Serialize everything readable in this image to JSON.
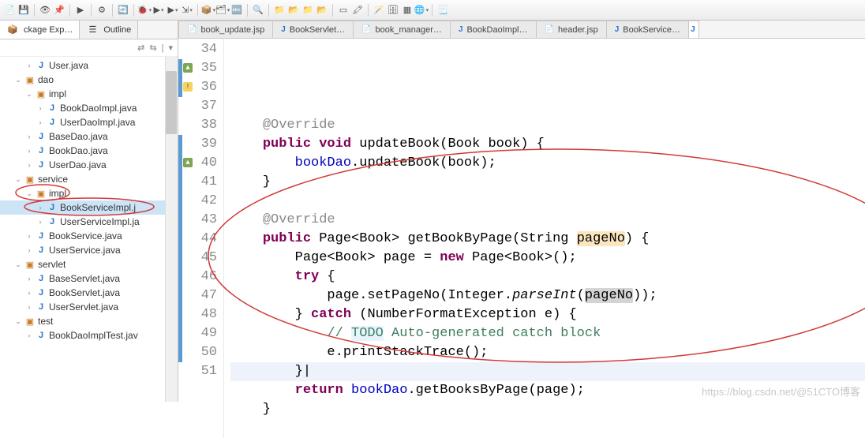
{
  "toolbar": {
    "icons": [
      "new",
      "save",
      "sep",
      "view",
      "pin",
      "sep",
      "play-green",
      "sep",
      "gear",
      "sep",
      "refresh",
      "sep",
      "debug-dd",
      "run-dd",
      "run2-dd",
      "ext-dd",
      "sep",
      "cube-dd",
      "proj-dd",
      "search-ab",
      "sep",
      "magnify",
      "sep",
      "folder1",
      "folder2",
      "folder3",
      "folder4",
      "sep",
      "box",
      "hl",
      "sep",
      "wand",
      "db",
      "grid",
      "globe-dd",
      "sep",
      "doc"
    ]
  },
  "left_panel": {
    "tabs": [
      {
        "label": "ckage Exp…",
        "icon": "📦"
      },
      {
        "label": "Outline",
        "icon": "☰"
      }
    ],
    "mini": [
      "⇄",
      "⇆",
      "|",
      "▾"
    ]
  },
  "tree": [
    {
      "d": 2,
      "tw": ">",
      "ic": "J",
      "cls": "junit",
      "label": "User.java"
    },
    {
      "d": 1,
      "tw": "v",
      "ic": "▢",
      "cls": "pkg",
      "label": "dao"
    },
    {
      "d": 2,
      "tw": "v",
      "ic": "▢",
      "cls": "pkg",
      "label": "impl"
    },
    {
      "d": 3,
      "tw": ">",
      "ic": "J",
      "cls": "junit",
      "label": "BookDaoImpl.java"
    },
    {
      "d": 3,
      "tw": ">",
      "ic": "J",
      "cls": "junit",
      "label": "UserDaoImpl.java"
    },
    {
      "d": 2,
      "tw": ">",
      "ic": "J",
      "cls": "junit",
      "label": "BaseDao.java"
    },
    {
      "d": 2,
      "tw": ">",
      "ic": "J",
      "cls": "junit",
      "label": "BookDao.java"
    },
    {
      "d": 2,
      "tw": ">",
      "ic": "J",
      "cls": "junit",
      "label": "UserDao.java"
    },
    {
      "d": 1,
      "tw": "v",
      "ic": "▢",
      "cls": "pkg",
      "label": "service"
    },
    {
      "d": 2,
      "tw": "v",
      "ic": "▢",
      "cls": "pkg",
      "label": "impl",
      "circ": "small"
    },
    {
      "d": 3,
      "tw": ">",
      "ic": "J",
      "cls": "junit",
      "label": "BookServiceImpl.j",
      "sel": true,
      "circ": "big"
    },
    {
      "d": 3,
      "tw": ">",
      "ic": "J",
      "cls": "junit",
      "label": "UserServiceImpl.ja"
    },
    {
      "d": 2,
      "tw": ">",
      "ic": "J",
      "cls": "junit",
      "label": "BookService.java"
    },
    {
      "d": 2,
      "tw": ">",
      "ic": "J",
      "cls": "junit",
      "label": "UserService.java"
    },
    {
      "d": 1,
      "tw": "v",
      "ic": "▢",
      "cls": "pkg",
      "label": "servlet"
    },
    {
      "d": 2,
      "tw": ">",
      "ic": "J",
      "cls": "junit",
      "label": "BaseServlet.java"
    },
    {
      "d": 2,
      "tw": ">",
      "ic": "J",
      "cls": "junit",
      "label": "BookServlet.java"
    },
    {
      "d": 2,
      "tw": ">",
      "ic": "J",
      "cls": "junit",
      "label": "UserServlet.java"
    },
    {
      "d": 1,
      "tw": "v",
      "ic": "▢",
      "cls": "pkg",
      "label": "test"
    },
    {
      "d": 2,
      "tw": ">",
      "ic": "J",
      "cls": "junit",
      "label": "BookDaoImplTest.jav"
    }
  ],
  "editor_tabs": [
    {
      "ic": "📄",
      "label": "book_update.jsp"
    },
    {
      "ic": "J",
      "label": "BookServlet…"
    },
    {
      "ic": "📄",
      "label": "book_manager…"
    },
    {
      "ic": "J",
      "label": "BookDaoImpl…"
    },
    {
      "ic": "📄",
      "label": "header.jsp"
    },
    {
      "ic": "J",
      "label": "BookService…"
    }
  ],
  "code": {
    "start": 34,
    "lines": [
      {
        "n": 34,
        "html": ""
      },
      {
        "n": 35,
        "mod": true,
        "mk": "ov",
        "html": "    <span class='ann'>@Override</span>"
      },
      {
        "n": 36,
        "mod": true,
        "mk": "wr",
        "html": "    <span class='kw'>public</span> <span class='kw'>void</span> updateBook(Book book) {"
      },
      {
        "n": 37,
        "html": "        <span class='fld'>bookDao</span>.updateBook(book);"
      },
      {
        "n": 38,
        "html": "    }"
      },
      {
        "n": 39,
        "mod": true,
        "html": ""
      },
      {
        "n": 40,
        "mod": true,
        "mk": "ov",
        "html": "    <span class='ann'>@Override</span>"
      },
      {
        "n": 41,
        "mod": true,
        "html": "    <span class='kw'>public</span> Page&lt;Book&gt; getBookByPage(String <span class='hl'>pageNo</span>) {"
      },
      {
        "n": 42,
        "mod": true,
        "html": "        Page&lt;Book&gt; page = <span class='kw'>new</span> Page&lt;Book&gt;();"
      },
      {
        "n": 43,
        "mod": true,
        "html": "        <span class='kw'>try</span> {"
      },
      {
        "n": 44,
        "mod": true,
        "html": "            page.setPageNo(Integer.<span style='font-style:italic'>parseInt</span>(<span class='hl2'>pageNo</span>));"
      },
      {
        "n": 45,
        "mod": true,
        "html": "        } <span class='kw'>catch</span> (NumberFormatException e) {"
      },
      {
        "n": 46,
        "mod": true,
        "html": "            <span class='cmt'>// <span style='background:#e8f4fd'>TODO</span> Auto-generated catch block</span>"
      },
      {
        "n": 47,
        "mod": true,
        "html": "            e.printStackTrace();"
      },
      {
        "n": 48,
        "mod": true,
        "cur": true,
        "html": "        }|"
      },
      {
        "n": 49,
        "mod": true,
        "html": "        <span class='kw'>return</span> <span class='fld'>bookDao</span>.getBooksByPage(page);"
      },
      {
        "n": 50,
        "mod": true,
        "html": "    }"
      },
      {
        "n": 51,
        "html": ""
      }
    ]
  },
  "watermark": "https://blog.csdn.net/@51CTO博客"
}
